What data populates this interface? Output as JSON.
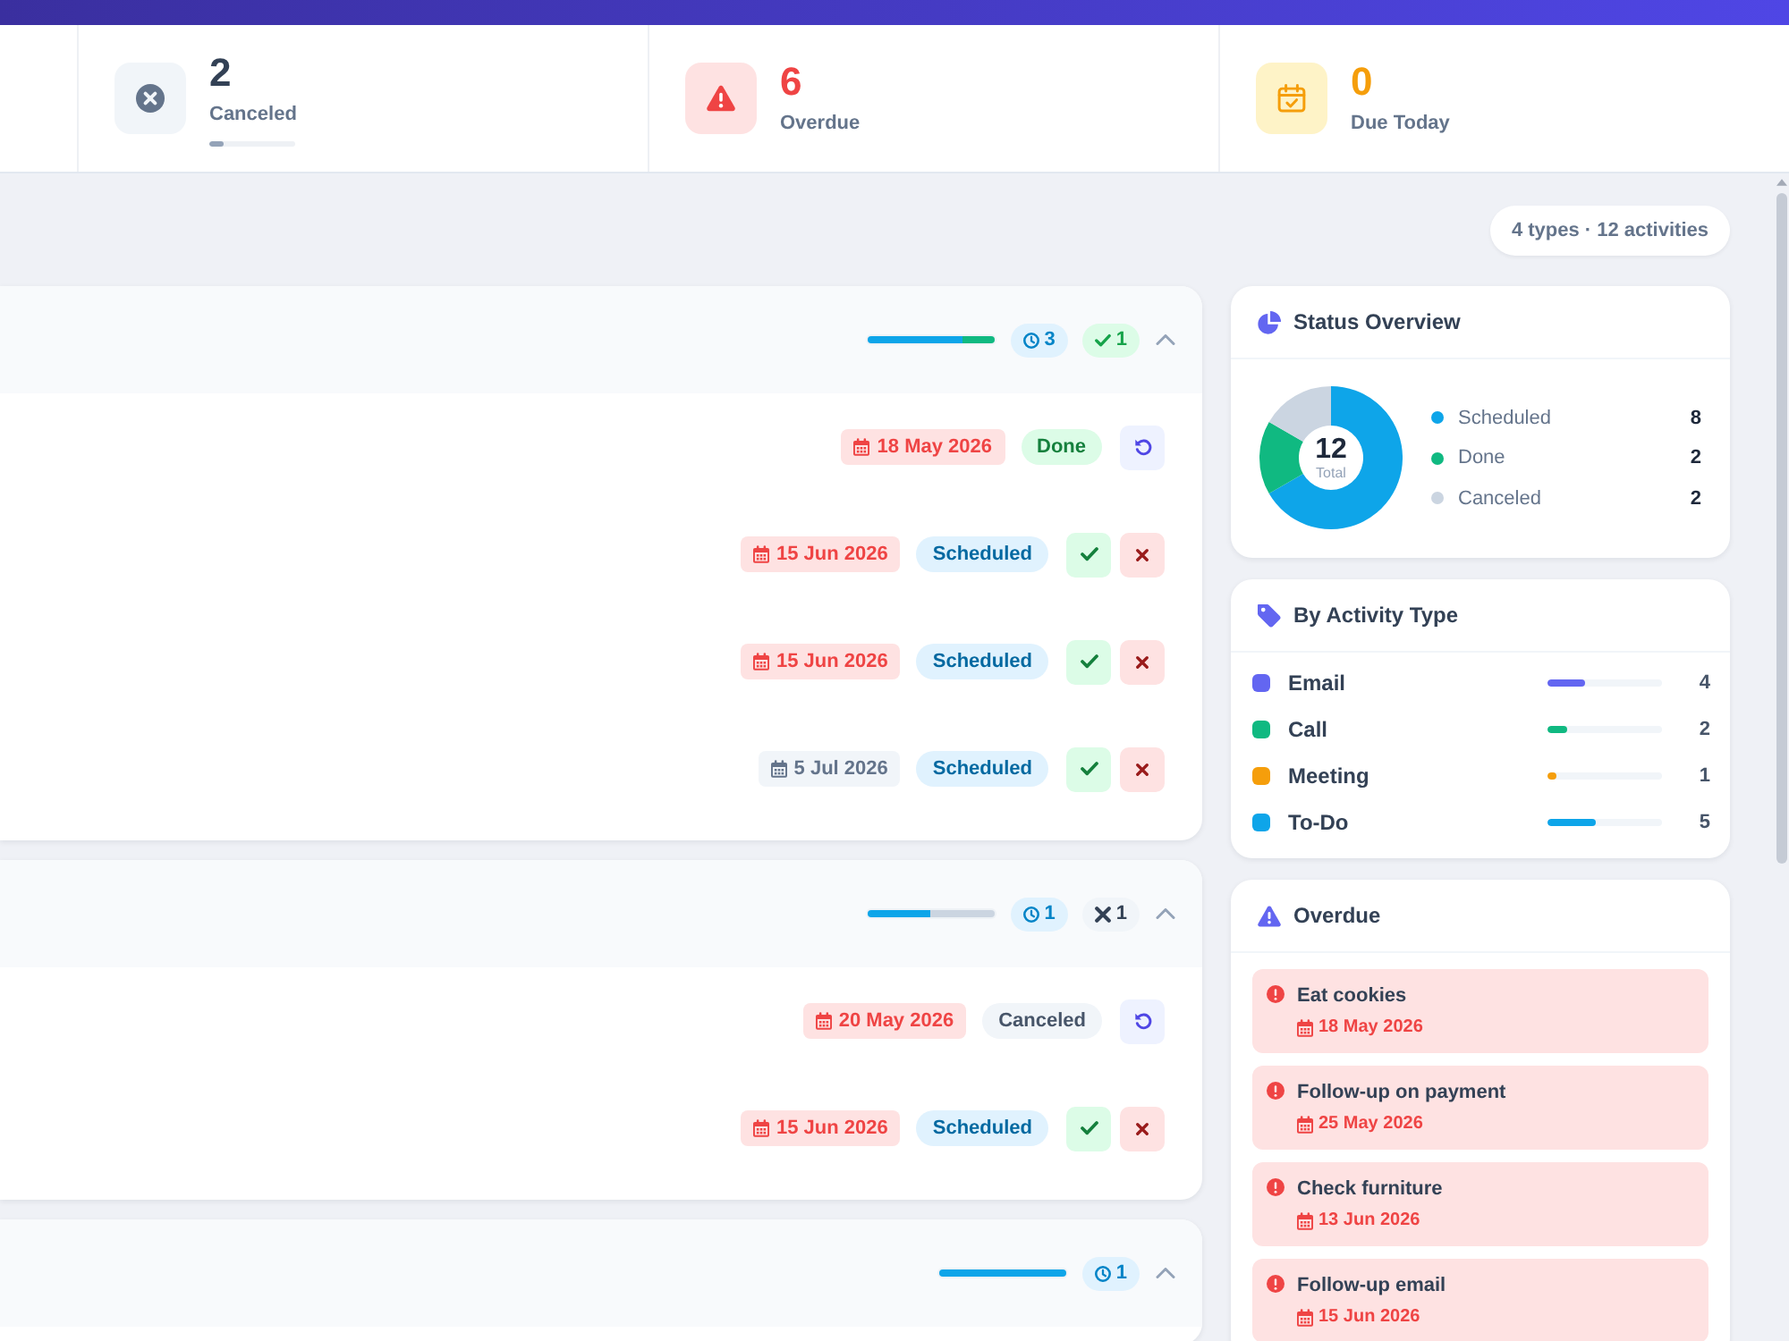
{
  "stats": [
    {
      "kind": "canceled",
      "value": "2",
      "label": "Canceled",
      "level": 0.17
    },
    {
      "kind": "overdue",
      "value": "6",
      "label": "Overdue"
    },
    {
      "kind": "due_today",
      "value": "0",
      "label": "Due Today"
    }
  ],
  "summary": "4 types · 12 activities",
  "groups": [
    {
      "expanded": true,
      "progress": [
        {
          "kind": "scheduled",
          "level": 0.75
        },
        {
          "kind": "done",
          "level": 0.25
        }
      ],
      "counts": [
        {
          "kind": "scheduled",
          "text": "3"
        },
        {
          "kind": "done",
          "text": "1"
        }
      ],
      "activities": [
        {
          "date": "18 May 2026",
          "past": true,
          "status": {
            "kind": "done",
            "label": "Done"
          }
        },
        {
          "date": "15 Jun 2026",
          "past": true,
          "status": {
            "kind": "scheduled",
            "label": "Scheduled"
          }
        },
        {
          "date": "15 Jun 2026",
          "past": true,
          "status": {
            "kind": "scheduled",
            "label": "Scheduled"
          }
        },
        {
          "date": "5 Jul 2026",
          "past": false,
          "status": {
            "kind": "scheduled",
            "label": "Scheduled"
          }
        }
      ]
    },
    {
      "expanded": true,
      "progress": [
        {
          "kind": "scheduled",
          "level": 0.5
        },
        {
          "kind": "canceled",
          "level": 0.5
        }
      ],
      "counts": [
        {
          "kind": "scheduled",
          "text": "1"
        },
        {
          "kind": "canceled",
          "text": "1"
        }
      ],
      "activities": [
        {
          "date": "20 May 2026",
          "past": true,
          "status": {
            "kind": "canceled",
            "label": "Canceled"
          }
        },
        {
          "date": "15 Jun 2026",
          "past": true,
          "status": {
            "kind": "scheduled",
            "label": "Scheduled"
          }
        }
      ]
    },
    {
      "expanded": true,
      "progress": [
        {
          "kind": "scheduled",
          "level": 1
        }
      ],
      "counts": [
        {
          "kind": "scheduled",
          "text": "1"
        }
      ]
    }
  ],
  "status_overview": {
    "title": "Status Overview",
    "total": "12",
    "total_label": "Total",
    "chart_data": {
      "type": "donut",
      "categories": [
        "Scheduled",
        "Done",
        "Canceled"
      ],
      "values": [
        66.67,
        16.67,
        16.66
      ]
    },
    "legend": [
      {
        "count": "8",
        "color": "#0ea5e9"
      },
      {
        "count": "2",
        "color": "#10b981"
      },
      {
        "count": "2",
        "color": "#cbd5e1"
      }
    ]
  },
  "activity_types": {
    "title": "By Activity Type",
    "items": [
      {
        "label": "Email",
        "count": "4",
        "color": "#6366f1",
        "level": 0.33
      },
      {
        "label": "Call",
        "count": "2",
        "color": "#10b981",
        "level": 0.17
      },
      {
        "label": "Meeting",
        "count": "1",
        "color": "#f59e0b",
        "level": 0.08
      },
      {
        "label": "To-Do",
        "count": "5",
        "color": "#0ea5e9",
        "level": 0.42
      }
    ]
  },
  "overdue": {
    "title": "Overdue",
    "items": [
      {
        "title": "Eat cookies",
        "date": "18 May 2026"
      },
      {
        "title": "Follow-up on payment",
        "date": "25 May 2026"
      },
      {
        "title": "Check furniture",
        "date": "13 Jun 2026"
      },
      {
        "title": "Follow-up email",
        "date": "15 Jun 2026"
      }
    ]
  }
}
